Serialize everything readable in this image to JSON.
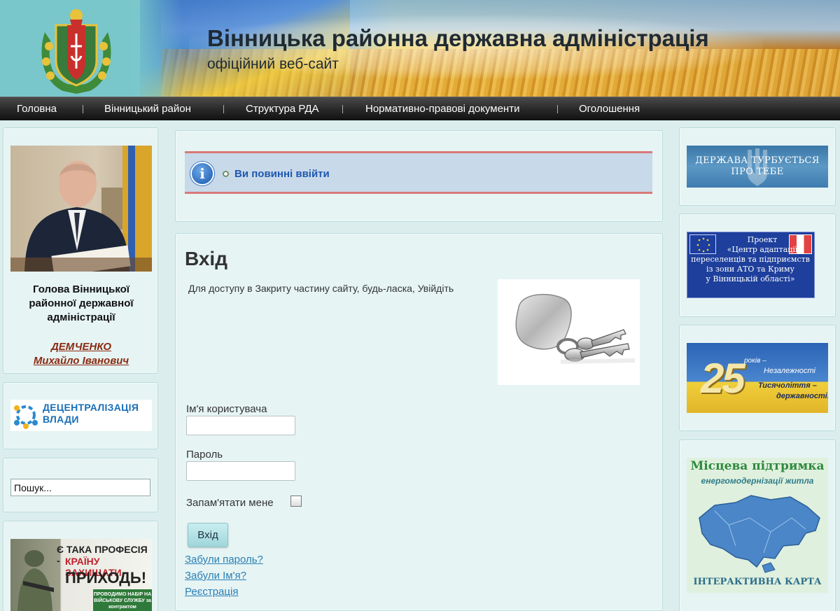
{
  "header": {
    "title": "Вінницька районна державна адміністрація",
    "subtitle": "офіційний веб-сайт"
  },
  "nav": {
    "items": [
      "Головна",
      "Вінницький район",
      "Структура РДА",
      "Нормативно-правові документи",
      "Оголошення"
    ]
  },
  "left": {
    "leader_caption": "Голова Вінницької районної державної адміністрації",
    "leader_name_1": "ДЕМЧЕНКО",
    "leader_name_2": "Михайло Іванович",
    "decentr_1": "ДЕЦЕНТРАЛІЗАЦІЯ",
    "decentr_2": "ВЛАДИ",
    "search_value": "Пошук...",
    "army_1": "Є ТАКА ПРОФЕСІЯ -",
    "army_2": "КРАЇНУ ЗАХИЩАТИ",
    "army_3": "ПРИХОДЬ!",
    "army_4": "ПРОВОДИМО НАБІР НА ВІЙСЬКОВУ СЛУЖБУ за контрактом"
  },
  "notice": {
    "message": "Ви повинні ввійти"
  },
  "login": {
    "title": "Вхід",
    "description": "Для доступу в Закриту частину сайту, будь-ласка, Увійдіть",
    "username_label": "Ім'я користувача",
    "password_label": "Пароль",
    "remember_label": "Запам'ятати мене",
    "submit_label": "Вхід",
    "forgot_password": "Забули пароль?",
    "forgot_username": "Забули Ім'я?",
    "register": "Реєстрація"
  },
  "right": {
    "b1_1": "ДЕРЖАВА ТУРБУЄТЬСЯ",
    "b1_2": "ПРО ТЕБЕ",
    "b2_0": "Проект",
    "b2_1": "«Центр адаптації",
    "b2_2": "переселенців та підприємств",
    "b2_3": "із зони АТО та Криму",
    "b2_4": "у Вінницькій області»",
    "b3_num": "25",
    "b3_1": "років –",
    "b3_2": "Незалежності",
    "b3_3": "Тисячоліття –",
    "b3_4": "державності!",
    "b4_1": "Місцева підтримка",
    "b4_2": "енергомодернізації житла",
    "b4_3": "ІНТЕРАКТИВНА КАРТА"
  },
  "colors": {
    "page_bg": "#dbeeed",
    "nav_bg": "#222222",
    "notice_bg": "#c8d9e9",
    "notice_border": "#d97a7a",
    "link": "#2a7fb5",
    "leader_link": "#8b2a10"
  }
}
